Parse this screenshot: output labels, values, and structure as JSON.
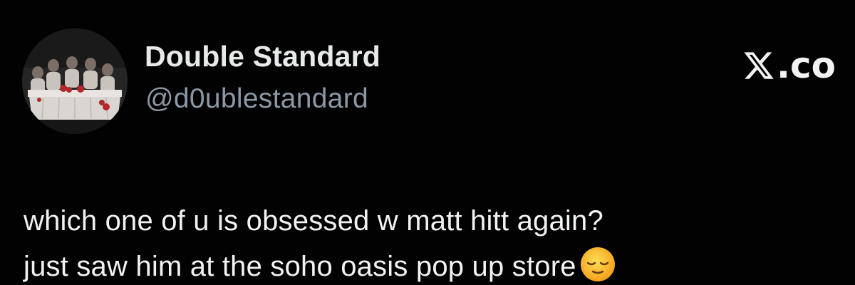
{
  "author": {
    "display_name": "Double Standard",
    "handle": "@d0ublestandard",
    "avatar_icon": "group-photo-avatar"
  },
  "watermark": {
    "logo_icon": "x-logo-icon",
    "text": ".co"
  },
  "tweet": {
    "lines": [
      "which one of u is obsessed w matt hitt again?",
      "just saw him at the soho oasis pop up store"
    ],
    "trailing_emoji_icon": "relieved-face-emoji"
  },
  "colors": {
    "background": "#020202",
    "name": "#e7e9ea",
    "handle": "#8b98a5",
    "body": "#f1f2f3"
  }
}
